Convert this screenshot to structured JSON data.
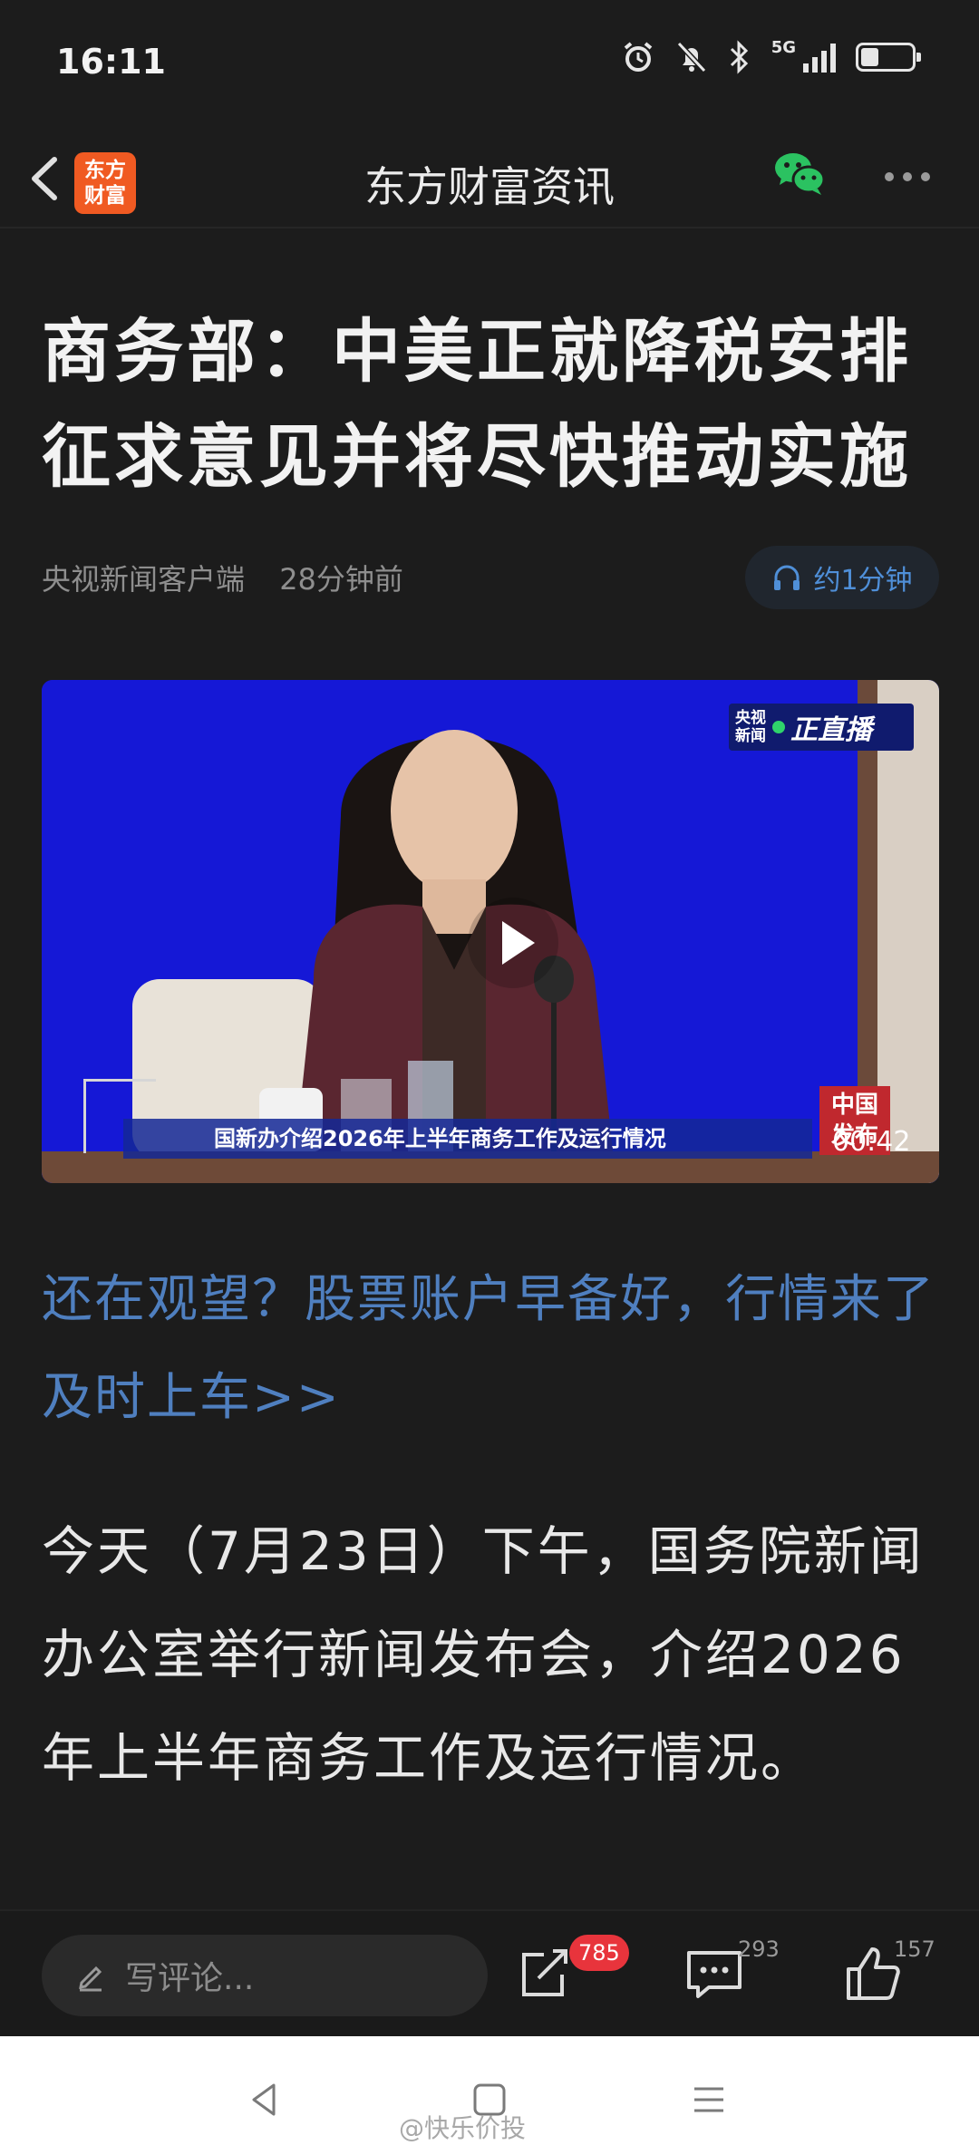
{
  "status_bar": {
    "time": "16:11",
    "network_label": "5G",
    "icons": [
      "alarm-icon",
      "mute-bell-icon",
      "bluetooth-icon",
      "signal-icon",
      "battery-icon"
    ],
    "battery_level": 0.35
  },
  "header": {
    "app_logo_text": "东方\n财富",
    "title": "东方财富资讯",
    "brand_color": "#f05a22",
    "wechat_color": "#2bc261"
  },
  "article": {
    "headline": "商务部：中美正就降税安排征求意见并将尽快推动实施",
    "source": "央视新闻客户端",
    "time_ago": "28分钟前",
    "listen_label": "约1分钟"
  },
  "video": {
    "live_badge_top": "央视",
    "live_badge_bottom": "新闻",
    "live_label": "正直播",
    "caption": "国新办介绍2026年上半年商务工作及运行情况",
    "corner_logo": "中国\n发布",
    "duration": "00:42"
  },
  "promo_text": "还在观望？股票账户早备好，行情来了及时上车>>",
  "body_text": "今天（7月23日）下午，国务院新闻办公室举行新闻发布会，介绍2026年上半年商务工作及运行情况。",
  "action_bar": {
    "comment_placeholder": "写评论...",
    "share_badge": "785",
    "comment_count": "293",
    "like_count": "157"
  },
  "nav_bar": {
    "watermark": "@快乐价投"
  }
}
